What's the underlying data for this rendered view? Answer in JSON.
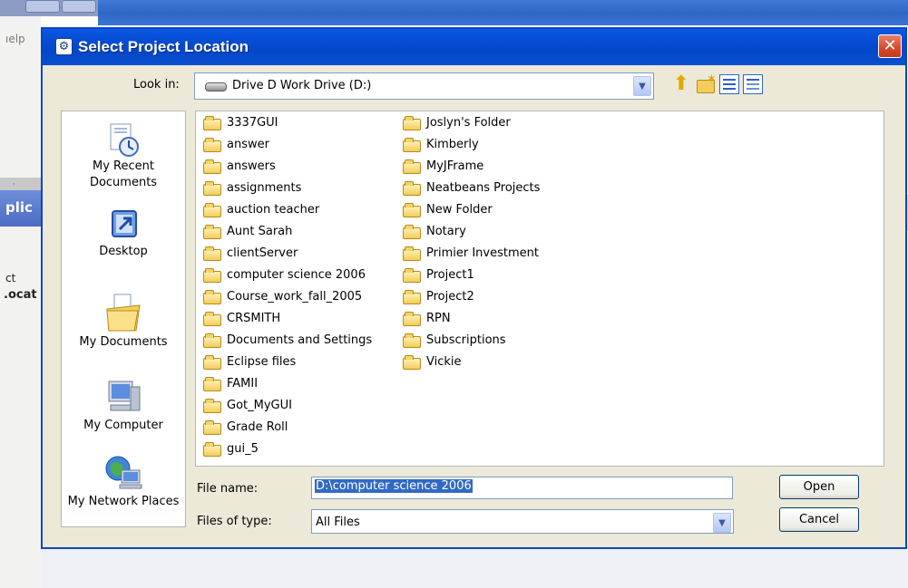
{
  "background": {
    "menu_partial": "ıelp",
    "blue_panel_partial": "plic",
    "label_partial_1": "ct",
    "label_partial_2": ".ocat",
    "scroll_glyph": "·"
  },
  "dialog": {
    "title": "Select Project Location",
    "close_glyph": "✕",
    "look_in_label": "Look in:",
    "look_in_value": "Drive D Work Drive (D:)",
    "toolbar": {
      "up_icon": "up-one-level-icon",
      "new_folder_icon": "create-new-folder-icon",
      "list_icon": "list-view-icon",
      "details_icon": "details-view-icon"
    },
    "places": [
      {
        "label": "My Recent Documents",
        "icon": "recent-documents-icon"
      },
      {
        "label": "Desktop",
        "icon": "desktop-icon"
      },
      {
        "label": "My Documents",
        "icon": "my-documents-icon"
      },
      {
        "label": "My Computer",
        "icon": "my-computer-icon"
      },
      {
        "label": "My Network Places",
        "icon": "network-places-icon"
      }
    ],
    "files_col1": [
      "3337GUI",
      "answer",
      "answers",
      "assignments",
      "auction teacher",
      "Aunt Sarah",
      "clientServer",
      "computer science 2006",
      "Course_work_fall_2005",
      "CRSMITH",
      "Documents and Settings",
      "Eclipse files",
      "FAMII",
      "Got_MyGUI",
      "Grade Roll",
      "gui_5"
    ],
    "files_col2": [
      "Joslyn's Folder",
      "Kimberly",
      "MyJFrame",
      "Neatbeans Projects",
      "New Folder",
      "Notary",
      "Primier Investment",
      "Project1",
      "Project2",
      "RPN",
      "Subscriptions",
      "Vickie"
    ],
    "file_name_label": "File name:",
    "file_name_value": "D:\\computer science 2006",
    "files_of_type_label": "Files of type:",
    "files_of_type_value": "All Files",
    "open_label": "Open",
    "cancel_label": "Cancel",
    "colors": {
      "title_bar": "#0347c9",
      "selection": "#316ac5",
      "dialog_bg": "#ece9d8",
      "close_button": "#d4492b"
    }
  }
}
